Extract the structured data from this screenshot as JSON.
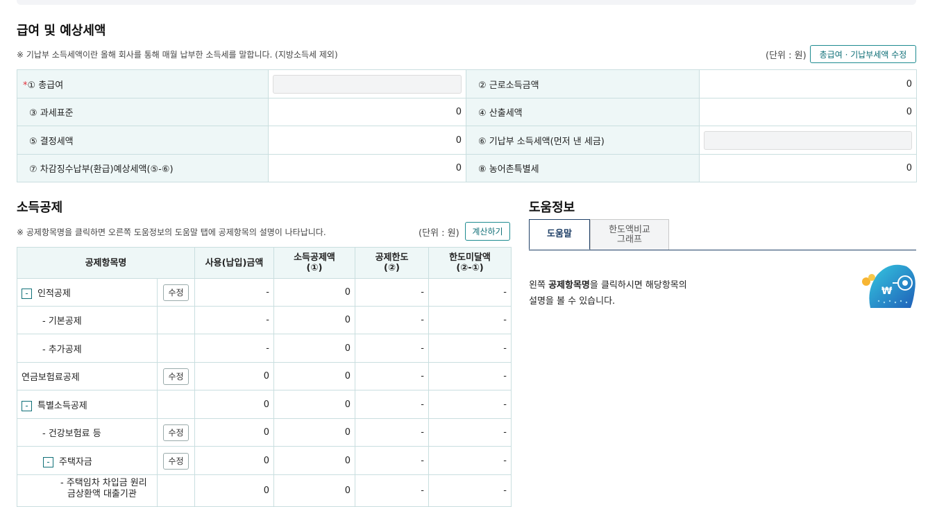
{
  "salary": {
    "title": "급여 및 예상세액",
    "note": "※ 기납부 소득세액이란 올해 회사를 통해 매월 납부한 소득세를 말합니다. (지방소득세 제외)",
    "unit": "(단위 : 원)",
    "edit_button": "총급여 · 기납부세액 수정",
    "rows": [
      {
        "l1": "① 총급여",
        "v1": "",
        "l2": "② 근로소득금액",
        "v2": "0"
      },
      {
        "l1": "③ 과세표준",
        "v1": "0",
        "l2": "④ 산출세액",
        "v2": "0"
      },
      {
        "l1": "⑤ 결정세액",
        "v1": "0",
        "l2": "⑥ 기납부 소득세액(먼저 낸 세금)",
        "v2": ""
      },
      {
        "l1": "⑦ 차감징수납부(환급)예상세액(⑤-⑥)",
        "v1": "0",
        "l2": "⑧ 농어촌특별세",
        "v2": "0"
      }
    ],
    "required_mark": "*"
  },
  "deduction": {
    "title": "소득공제",
    "note": "※ 공제항목명을 클릭하면 오른쪽 도움정보의 도움말 탭에 공제항목의 설명이 나타납니다.",
    "unit": "(단위 : 원)",
    "calc_button": "계산하기",
    "headers": {
      "name": "공제항목명",
      "paid": "사용(납입)금액",
      "amount1": "소득공제액",
      "amount2": "(①)",
      "limit1": "공제한도",
      "limit2": "(②)",
      "under1": "한도미달액",
      "under2": "(②-①)"
    },
    "edit_label": "수정",
    "toggle_label": "-",
    "rows": [
      {
        "name": "인적공제",
        "paid": "-",
        "amount": "0",
        "limit": "-",
        "under": "-"
      },
      {
        "name": "- 기본공제",
        "paid": "-",
        "amount": "0",
        "limit": "-",
        "under": "-"
      },
      {
        "name": "- 추가공제",
        "paid": "-",
        "amount": "0",
        "limit": "-",
        "under": "-"
      },
      {
        "name": "연금보험료공제",
        "paid": "0",
        "amount": "0",
        "limit": "-",
        "under": "-"
      },
      {
        "name": "특별소득공제",
        "paid": "0",
        "amount": "0",
        "limit": "-",
        "under": "-"
      },
      {
        "name": "- 건강보험료 등",
        "paid": "0",
        "amount": "0",
        "limit": "-",
        "under": "-"
      },
      {
        "name": "주택자금",
        "paid": "0",
        "amount": "0",
        "limit": "-",
        "under": "-"
      },
      {
        "name": "- 주택임차 차입금 원리",
        "name2": "금상환액 대출기관",
        "paid": "0",
        "amount": "0",
        "limit": "-",
        "under": "-"
      }
    ]
  },
  "help": {
    "title": "도움정보",
    "tab_active": "도움말",
    "tab_inactive_1": "한도액비교",
    "tab_inactive_2": "그래프",
    "text_prefix": "왼쪽 ",
    "text_bold": "공제항목명",
    "text_suffix": "을 클릭하시면 해당항목의",
    "text_line2": "설명을 볼 수 있습니다.",
    "mascot_symbol": "₩"
  },
  "colors": {
    "accent": "#0f6f77",
    "label_bg": "#eef7f7",
    "border": "#c9dedf",
    "tab_navy": "#1e3f66"
  }
}
